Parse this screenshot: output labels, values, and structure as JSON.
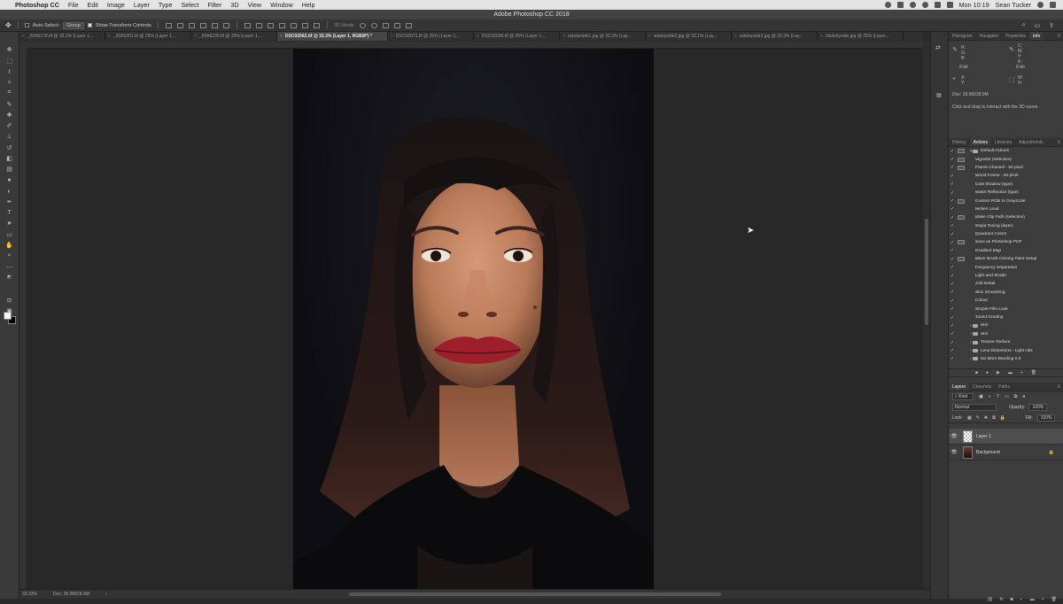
{
  "menubar": {
    "app": "Photoshop CC",
    "items": [
      "File",
      "Edit",
      "Image",
      "Layer",
      "Type",
      "Select",
      "Filter",
      "3D",
      "View",
      "Window",
      "Help"
    ],
    "clock": "Mon 10:19",
    "user": "Sean Tucker"
  },
  "window": {
    "title": "Adobe Photoshop CC 2018"
  },
  "options": {
    "auto_select": "Auto-Select:",
    "auto_select_mode": "Group",
    "transform_controls": "Show Transform Controls",
    "mode_3d": "3D Mode:"
  },
  "tabs": [
    {
      "label": "_60A6178.tif @ 33.3% (Layer 1,..."
    },
    {
      "label": "_60A6201.tif @ 25% (Layer 1,..."
    },
    {
      "label": "_60A6230.tif @ 25% (Layer 1,..."
    },
    {
      "label": "DSC02062.tif @ 33.3% (Layer 1, RGB/8*) *"
    },
    {
      "label": "DSC02071.tif @ 25% (Layer 1,..."
    },
    {
      "label": "DSC02096.tif @ 25% (Layer 1,..."
    },
    {
      "label": "sidebyside1.jpg @ 33.3% (Lay..."
    },
    {
      "label": "sidebyside2.jpg @ 32.1% (Lay..."
    },
    {
      "label": "sidebyside3.jpg @ 33.3% (Lay..."
    },
    {
      "label": "3sidebyside.jpg @ 25% (Layer..."
    }
  ],
  "status": {
    "zoom": "33.33%",
    "doc": "Doc: 28.9M/28.9M"
  },
  "info_panel": {
    "tabs": [
      "Histogram",
      "Navigator",
      "Properties",
      "Info"
    ],
    "active": "Info",
    "rgb_labels": [
      "R:",
      "G:",
      "B:"
    ],
    "cmyk_labels": [
      "C:",
      "M:",
      "Y:",
      "K:"
    ],
    "bit_left": "8-bit",
    "bit_right": "8-bit",
    "xy_labels": [
      "X:",
      "Y:"
    ],
    "wh_labels": [
      "W:",
      "H:"
    ],
    "doc": "Doc: 28.9M/28.9M",
    "hint": "Click and drag to interact with the 3D scene."
  },
  "actions_panel": {
    "tabs": [
      "History",
      "Actions",
      "Libraries",
      "Adjustments"
    ],
    "active": "Actions",
    "rows": [
      {
        "type": "set",
        "label": "Default Actions",
        "dialog": true
      },
      {
        "type": "action",
        "label": "Vignette (selection)",
        "dialog": true
      },
      {
        "type": "action",
        "label": "Frame Channel - 50 pixel",
        "dialog": true
      },
      {
        "type": "action",
        "label": "Wood Frame - 50 pixel",
        "dialog": false
      },
      {
        "type": "action",
        "label": "Cast Shadow (type)",
        "dialog": false
      },
      {
        "type": "action",
        "label": "Water Reflection (type)",
        "dialog": false
      },
      {
        "type": "action",
        "label": "Custom RGB to Grayscale",
        "dialog": true
      },
      {
        "type": "action",
        "label": "Molten Lead",
        "dialog": false
      },
      {
        "type": "action",
        "label": "Make Clip Path (selection)",
        "dialog": true
      },
      {
        "type": "action",
        "label": "Sepia Toning (layer)",
        "dialog": false
      },
      {
        "type": "action",
        "label": "Quadrant Colors",
        "dialog": false
      },
      {
        "type": "action",
        "label": "Save as Photoshop PDF",
        "dialog": true
      },
      {
        "type": "action",
        "label": "Gradient Map",
        "dialog": false
      },
      {
        "type": "action",
        "label": "Mixer Brush Cloning Paint Setup",
        "dialog": true
      },
      {
        "type": "action",
        "label": "Frequency Separation",
        "dialog": false
      },
      {
        "type": "action",
        "label": "Light and Shade",
        "dialog": false
      },
      {
        "type": "action",
        "label": "Add Detail",
        "dialog": false
      },
      {
        "type": "action",
        "label": "Skin Smoothing",
        "dialog": false
      },
      {
        "type": "action",
        "label": "Colour",
        "dialog": false
      },
      {
        "type": "action",
        "label": "Simple Film Look",
        "dialog": false
      },
      {
        "type": "action",
        "label": "Tutvid Grading",
        "dialog": false
      },
      {
        "type": "set2",
        "label": "skin",
        "dialog": false
      },
      {
        "type": "set2",
        "label": "skin",
        "dialog": false
      },
      {
        "type": "set2",
        "label": "Texture Reduce",
        "dialog": false
      },
      {
        "type": "set2",
        "label": "Lens Distortions - Light Hits",
        "dialog": false
      },
      {
        "type": "set2",
        "label": "No More Banding 0.6",
        "dialog": false
      }
    ]
  },
  "layers_panel": {
    "tabs": [
      "Layers",
      "Channels",
      "Paths"
    ],
    "active": "Layers",
    "filter": "Kind",
    "blend": "Normal",
    "opacity_label": "Opacity:",
    "opacity": "100%",
    "lock_label": "Lock:",
    "fill_label": "Fill:",
    "fill": "100%",
    "layers": [
      {
        "name": "Layer 1",
        "selected": true,
        "kind": "transparent"
      },
      {
        "name": "Background",
        "selected": false,
        "kind": "image",
        "locked": true
      }
    ]
  }
}
